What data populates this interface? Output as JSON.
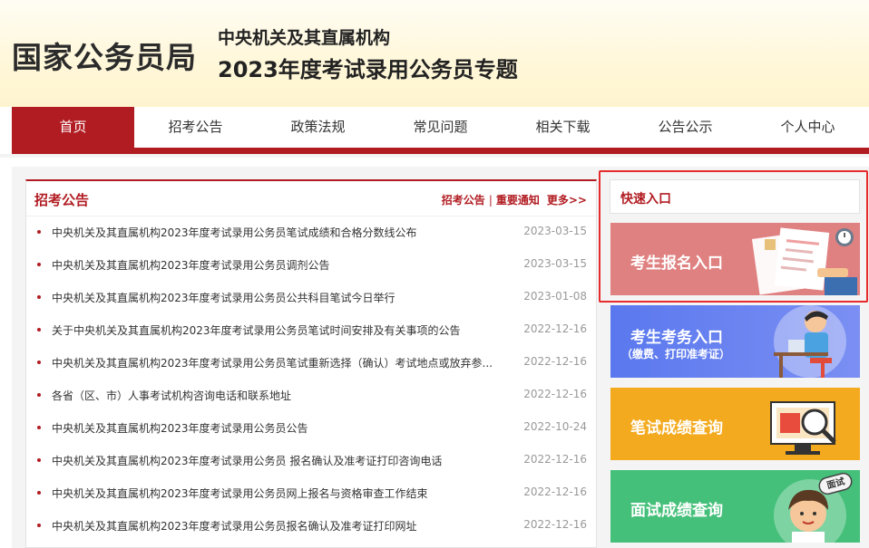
{
  "header": {
    "site_title": "国家公务员局",
    "subtitle_line1": "中央机关及其直属机构",
    "subtitle_line2": "2023年度考试录用公务员专题"
  },
  "nav": {
    "items": [
      {
        "label": "首页",
        "active": true
      },
      {
        "label": "招考公告"
      },
      {
        "label": "政策法规"
      },
      {
        "label": "常见问题"
      },
      {
        "label": "相关下载"
      },
      {
        "label": "公告公示"
      },
      {
        "label": "个人中心"
      }
    ]
  },
  "announcements": {
    "title": "招考公告",
    "links": [
      "招考公告",
      "重要通知"
    ],
    "more": "更多>>",
    "items": [
      {
        "title": "中央机关及其直属机构2023年度考试录用公务员笔试成绩和合格分数线公布",
        "date": "2023-03-15"
      },
      {
        "title": "中央机关及其直属机构2023年度考试录用公务员调剂公告",
        "date": "2023-03-15"
      },
      {
        "title": "中央机关及其直属机构2023年度考试录用公务员公共科目笔试今日举行",
        "date": "2023-01-08"
      },
      {
        "title": "关于中央机关及其直属机构2023年度考试录用公务员笔试时间安排及有关事项的公告",
        "date": "2022-12-16"
      },
      {
        "title": "中央机关及其直属机构2023年度考试录用公务员笔试重新选择（确认）考试地点或放弃参...",
        "date": "2022-12-16"
      },
      {
        "title": "各省（区、市）人事考试机构咨询电话和联系地址",
        "date": "2022-12-16"
      },
      {
        "title": "中央机关及其直属机构2023年度考试录用公务员公告",
        "date": "2022-10-24"
      },
      {
        "title": "中央机关及其直属机构2023年度考试录用公务员 报名确认及准考证打印咨询电话",
        "date": "2022-12-16"
      },
      {
        "title": "中央机关及其直属机构2023年度考试录用公务员网上报名与资格审查工作结束",
        "date": "2022-12-16"
      },
      {
        "title": "中央机关及其直属机构2023年度考试录用公务员报名确认及准考证打印网址",
        "date": "2022-12-16"
      }
    ]
  },
  "quick": {
    "title": "快速入口",
    "buttons": [
      {
        "label": "考生报名入口",
        "color": "#e08181"
      },
      {
        "label": "考生考务入口",
        "sub": "（缴费、打印准考证）",
        "color": "#5a78ee"
      },
      {
        "label": "笔试成绩查询",
        "color": "#f4aa1e"
      },
      {
        "label": "面试成绩查询",
        "color": "#45c07a",
        "badge": "面试"
      }
    ]
  },
  "colors": {
    "brand": "#b11c22",
    "highlight": "#e52b2b"
  }
}
